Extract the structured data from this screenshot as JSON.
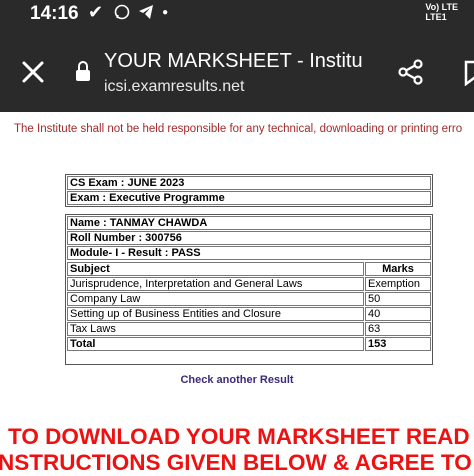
{
  "status_bar": {
    "time": "14:16",
    "icons": [
      "check-notification-icon",
      "whatsapp-icon",
      "telegram-icon",
      "dot-icon"
    ],
    "network_line1": "Vo) LTE",
    "network_line2": "LTE1"
  },
  "toolbar": {
    "title": "YOUR MARKSHEET - Institu...",
    "url": "icsi.examresults.net"
  },
  "disclaimer": "The Institute shall not be held responsible for any technical, downloading or printing erro",
  "exam": {
    "line1": "CS Exam : JUNE 2023",
    "line2": "Exam : Executive Programme"
  },
  "candidate": {
    "name": "Name :  TANMAY   CHAWDA",
    "roll": "Roll Number : 300756"
  },
  "marksheet": {
    "module": "Module- I -     Result : PASS",
    "header_subject": "Subject",
    "header_marks": "Marks",
    "rows": [
      {
        "subject": "Jurisprudence, Interpretation and General Laws",
        "marks": "Exemption"
      },
      {
        "subject": "Company Law",
        "marks": "50"
      },
      {
        "subject": "Setting up of Business Entities and Closure",
        "marks": "40"
      },
      {
        "subject": "Tax Laws",
        "marks": "63"
      }
    ],
    "total_label": "Total",
    "total_value": "153"
  },
  "check_another": "Check another Result",
  "banner": {
    "line1": "TO DOWNLOAD YOUR MARKSHEET READ THE",
    "line2": "NSTRUCTIONS GIVEN BELOW & AGREE TO THE"
  },
  "colors": {
    "toolbar_bg": "#2a2a2a",
    "disclaimer": "#a52a2a",
    "link": "#3b2a7a",
    "banner": "#ee1111"
  }
}
